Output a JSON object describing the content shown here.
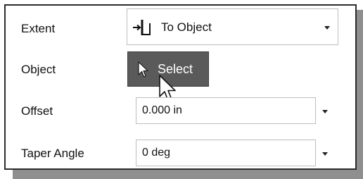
{
  "extent": {
    "label": "Extent",
    "value": "To Object",
    "icon": "to-object-icon"
  },
  "object": {
    "label": "Object",
    "button_label": "Select",
    "icon": "select-arrow-icon"
  },
  "offset": {
    "label": "Offset",
    "value": "0.000 in"
  },
  "taper": {
    "label": "Taper Angle",
    "value": "0 deg"
  }
}
